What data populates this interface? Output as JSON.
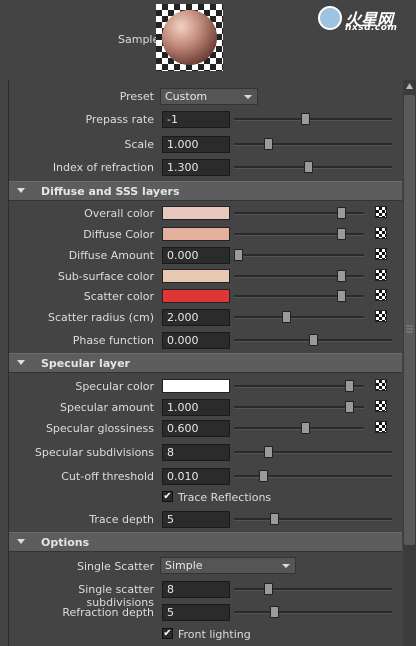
{
  "sample": {
    "label": "Sample"
  },
  "logo": {
    "main": "火星网",
    "sub": "hxsd.com"
  },
  "preset": {
    "label": "Preset",
    "value": "Custom"
  },
  "prepass_rate": {
    "label": "Prepass rate",
    "value": "-1",
    "slider": 0.45
  },
  "scale": {
    "label": "Scale",
    "value": "1.000",
    "slider": 0.2
  },
  "ior": {
    "label": "Index of refraction",
    "value": "1.300",
    "slider": 0.47
  },
  "diffuse_section": {
    "title": "Diffuse and SSS layers"
  },
  "overall_color": {
    "label": "Overall color",
    "color": "#e8c8bd",
    "slider": 0.85
  },
  "diffuse_color": {
    "label": "Diffuse Color",
    "color": "#e3b09d",
    "slider": 0.85
  },
  "diffuse_amount": {
    "label": "Diffuse Amount",
    "value": "0.000",
    "slider": 0.0
  },
  "subsurface_color": {
    "label": "Sub-surface color",
    "color": "#e8c8b3",
    "slider": 0.85
  },
  "scatter_color": {
    "label": "Scatter color",
    "color": "#e03535",
    "slider": 0.85
  },
  "scatter_radius": {
    "label": "Scatter radius (cm)",
    "value": "2.000",
    "slider": 0.4
  },
  "phase_function": {
    "label": "Phase function",
    "value": "0.000",
    "slider": 0.5
  },
  "specular_section": {
    "title": "Specular layer"
  },
  "specular_color": {
    "label": "Specular color",
    "color": "#ffffff",
    "slider": 0.92
  },
  "specular_amount": {
    "label": "Specular amount",
    "value": "1.000",
    "slider": 0.92
  },
  "specular_glossiness": {
    "label": "Specular glossiness",
    "value": "0.600",
    "slider": 0.55
  },
  "specular_subdivisions": {
    "label": "Specular subdivisions",
    "value": "8",
    "slider": 0.2
  },
  "cutoff_threshold": {
    "label": "Cut-off threshold",
    "value": "0.010",
    "slider": 0.17
  },
  "trace_reflections": {
    "label": "Trace Reflections",
    "checked": true
  },
  "trace_depth": {
    "label": "Trace depth",
    "value": "5",
    "slider": 0.24
  },
  "options_section": {
    "title": "Options"
  },
  "single_scatter": {
    "label": "Single Scatter",
    "value": "Simple"
  },
  "single_scatter_subdivisions": {
    "label": "Single scatter subdivisions",
    "value": "8",
    "slider": 0.2
  },
  "refraction_depth": {
    "label": "Refraction depth",
    "value": "5",
    "slider": 0.24
  },
  "front_lighting": {
    "label": "Front lighting",
    "checked": true
  }
}
